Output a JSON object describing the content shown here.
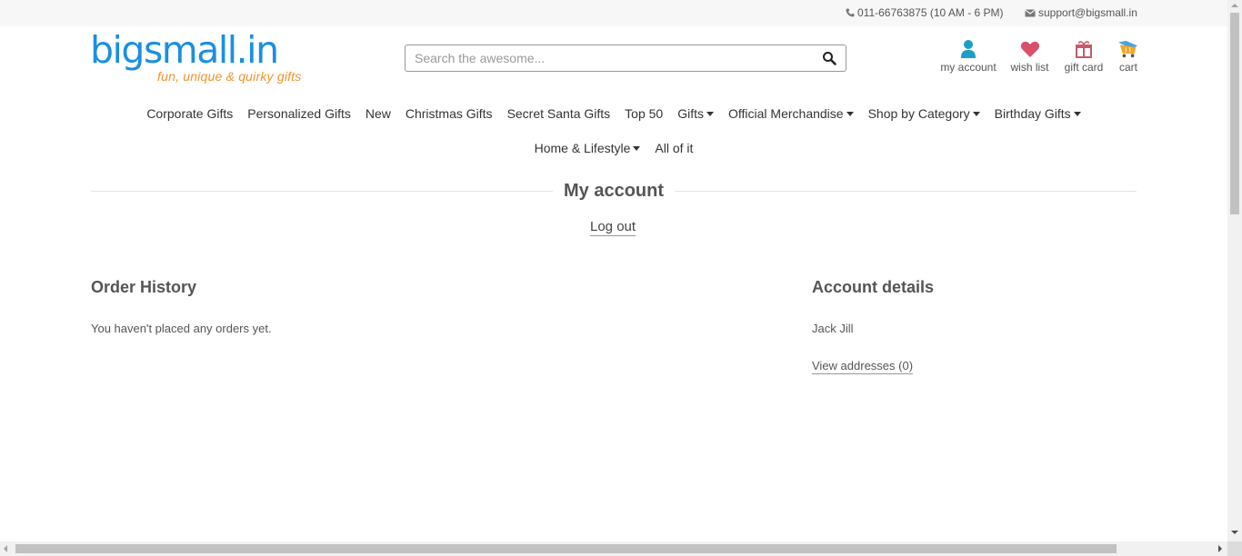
{
  "topbar": {
    "phone": "011-66763875 (10 AM - 6 PM)",
    "email": "support@bigsmall.in"
  },
  "logo": {
    "brand": "bigsmall.in",
    "tagline": "fun, unique & quirky gifts"
  },
  "search": {
    "placeholder": "Search the awesome..."
  },
  "header_links": {
    "account": "my account",
    "wishlist": "wish list",
    "giftcard": "gift card",
    "cart": "cart"
  },
  "nav": {
    "row1": [
      {
        "label": "Corporate Gifts"
      },
      {
        "label": "Personalized Gifts"
      },
      {
        "label": "New"
      },
      {
        "label": "Christmas Gifts"
      },
      {
        "label": "Secret Santa Gifts"
      },
      {
        "label": "Top 50"
      },
      {
        "label": "Gifts"
      },
      {
        "label": "Official Merchandise"
      },
      {
        "label": "Shop by Category"
      },
      {
        "label": "Birthday Gifts"
      }
    ],
    "row2": [
      {
        "label": "Home & Lifestyle"
      },
      {
        "label": "All of it"
      }
    ]
  },
  "page": {
    "title": "My account",
    "logout": "Log out"
  },
  "order_history": {
    "title": "Order History",
    "empty": "You haven't placed any orders yet."
  },
  "account_details": {
    "title": "Account details",
    "name": "Jack Jill",
    "addresses_link": "View addresses (0)"
  },
  "colors": {
    "brand_blue": "#1a8fe3",
    "brand_orange": "#f5922f",
    "account_icon": "#1a9fc9",
    "wishlist_icon": "#d9506b",
    "giftcard_icon": "#c65a6e"
  },
  "icons": {
    "phone": "phone-icon",
    "email": "envelope-icon",
    "search": "search-icon",
    "account": "user-icon",
    "wishlist": "heart-icon",
    "giftcard": "gift-icon",
    "cart": "cart-icon"
  }
}
